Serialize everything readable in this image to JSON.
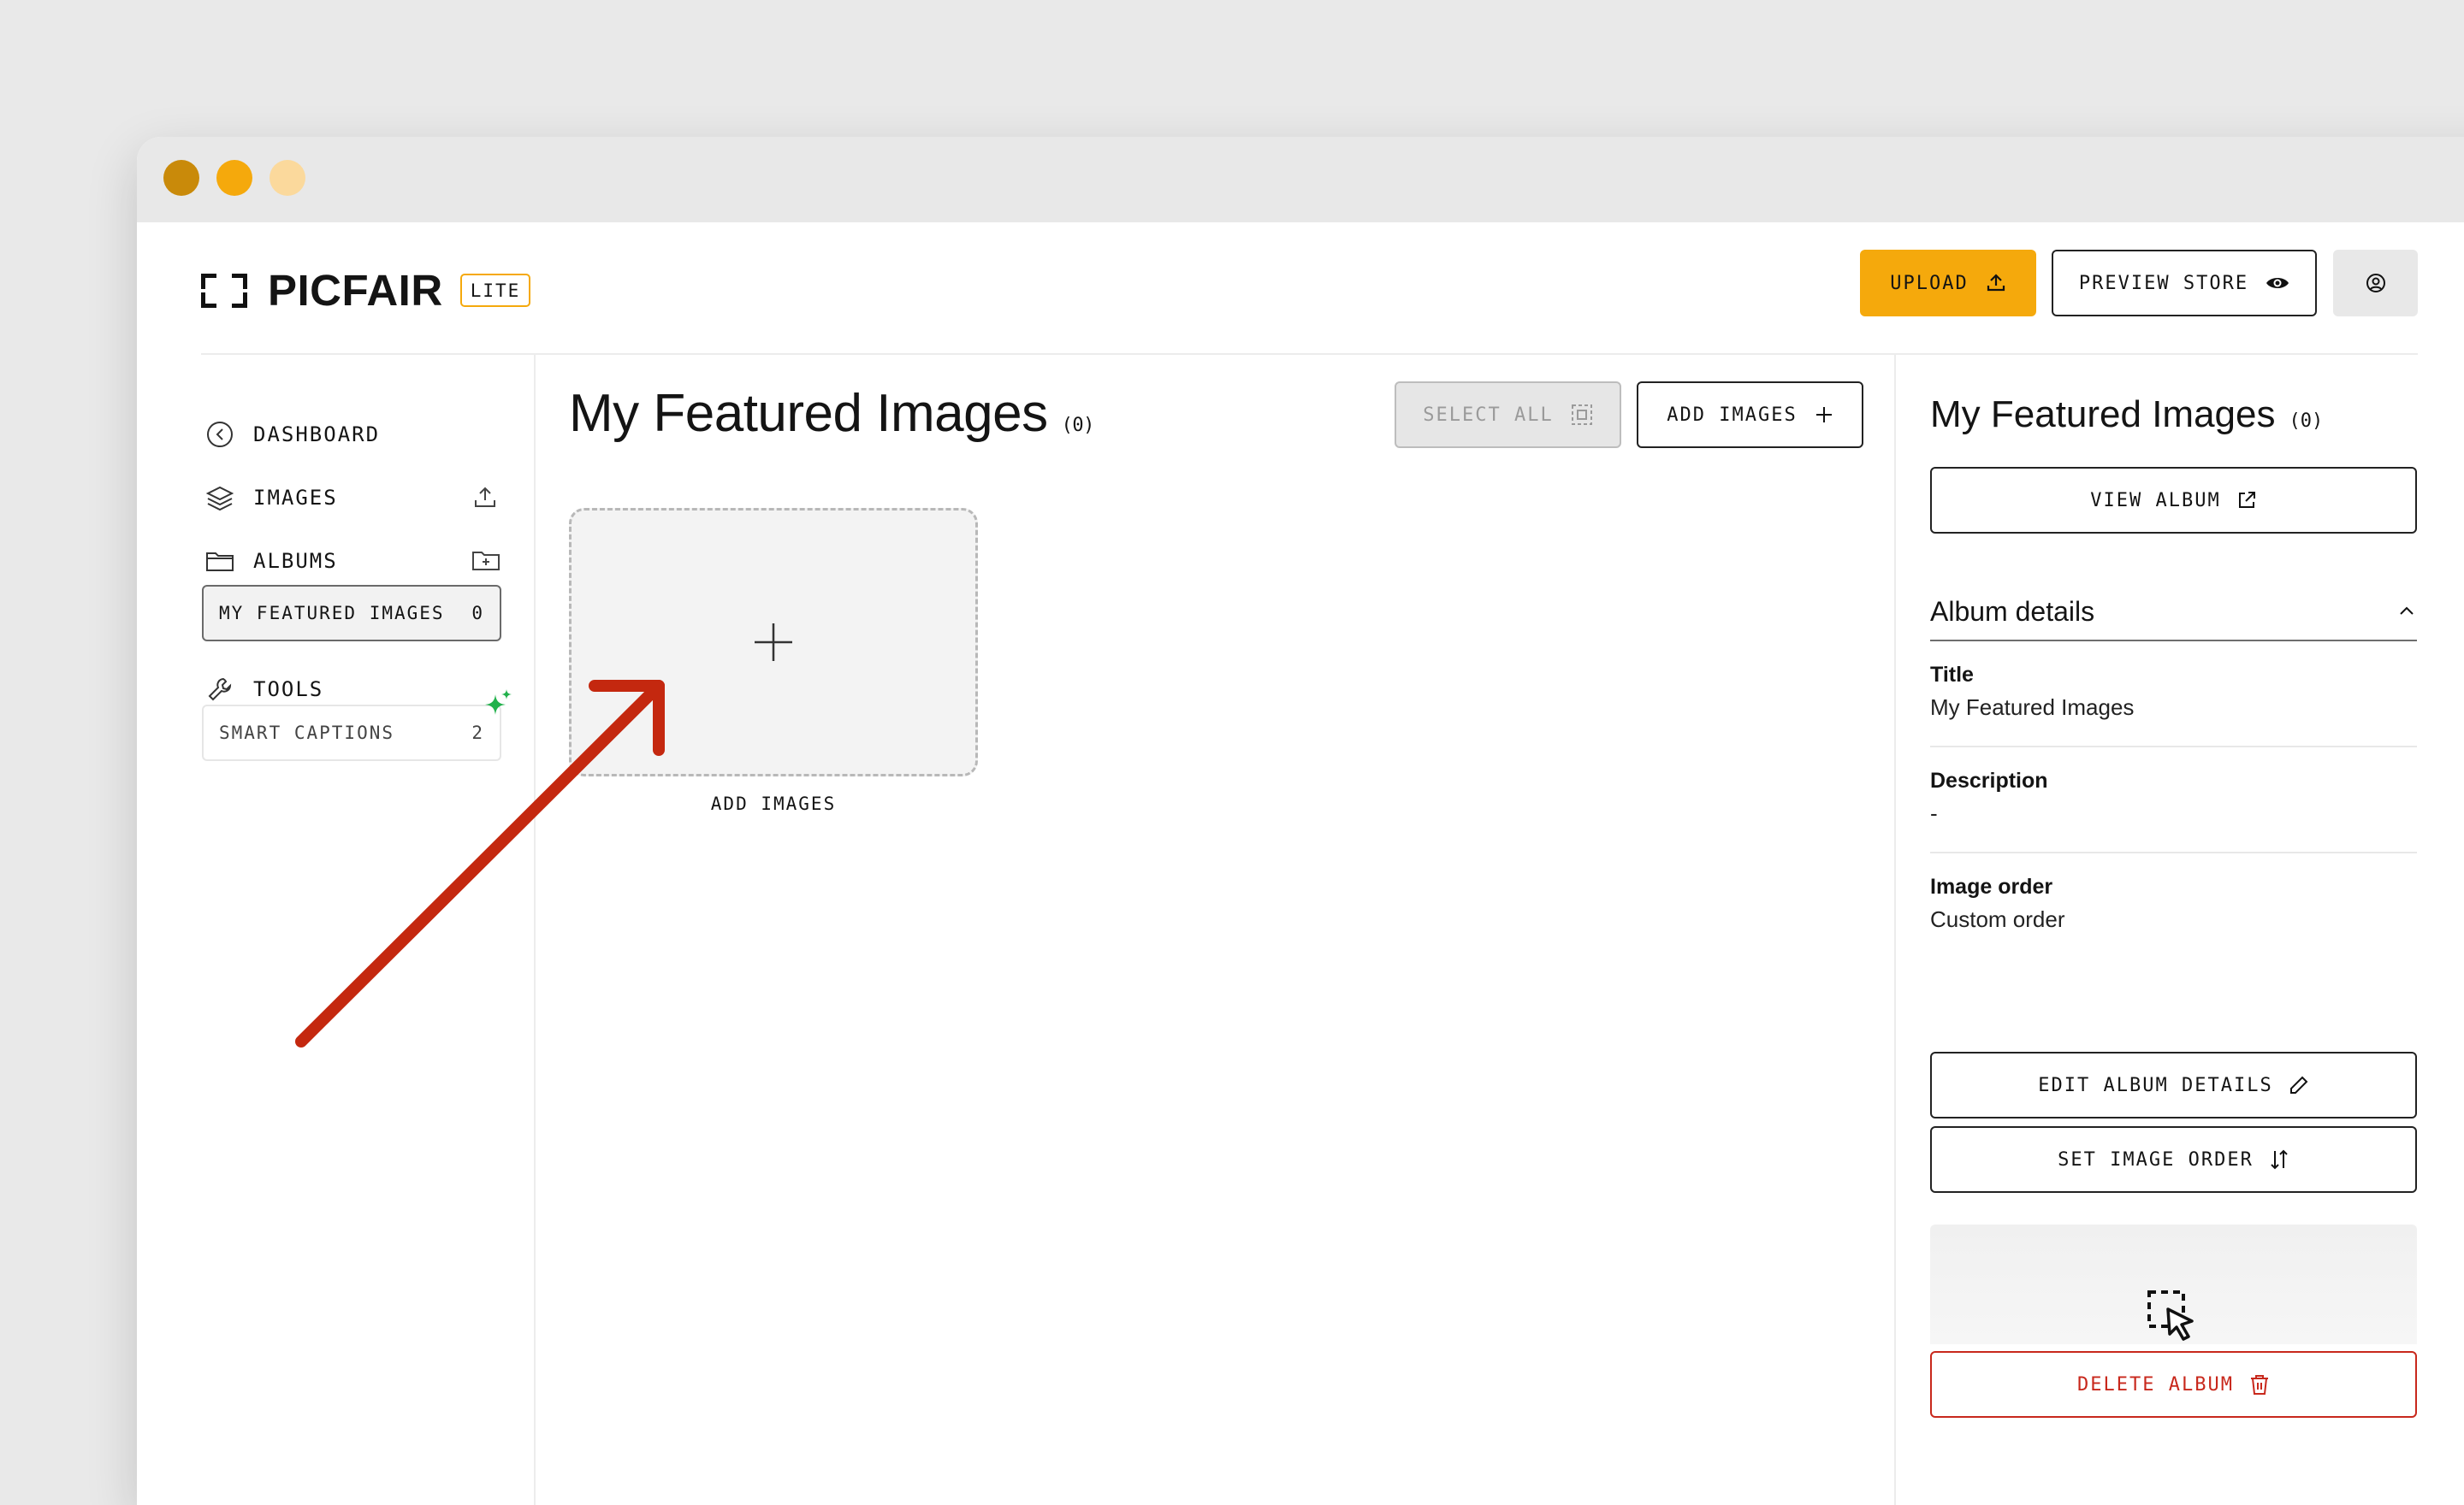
{
  "brand": {
    "name": "PICFAIR",
    "badge": "LITE"
  },
  "header": {
    "upload_label": "UPLOAD",
    "preview_label": "PREVIEW STORE"
  },
  "sidebar": {
    "items": [
      {
        "label": "DASHBOARD",
        "icon": "arrow-left-circle-icon"
      },
      {
        "label": "IMAGES",
        "icon": "layers-icon"
      },
      {
        "label": "ALBUMS",
        "icon": "folder-icon"
      },
      {
        "label": "TOOLS",
        "icon": "wrench-icon"
      }
    ],
    "albums": [
      {
        "label": "MY FEATURED IMAGES",
        "count": "0"
      }
    ],
    "tools": [
      {
        "label": "SMART CAPTIONS",
        "count": "2"
      }
    ]
  },
  "main": {
    "title": "My Featured Images",
    "count": "(0)",
    "select_all_label": "SELECT ALL",
    "add_images_label": "ADD IMAGES",
    "dropzone_label": "ADD IMAGES"
  },
  "panel": {
    "title": "My Featured Images",
    "count": "(0)",
    "view_album_label": "VIEW ALBUM",
    "details_heading": "Album details",
    "fields": [
      {
        "label": "Title",
        "value": "My Featured Images"
      },
      {
        "label": "Description",
        "value": "-"
      },
      {
        "label": "Image order",
        "value": "Custom order"
      }
    ],
    "edit_label": "EDIT ALBUM DETAILS",
    "order_label": "SET IMAGE ORDER",
    "delete_label": "DELETE ALBUM"
  },
  "colors": {
    "accent": "#f5a90c",
    "danger": "#c8281c",
    "annotation_arrow": "#c4280f",
    "sparkle": "#22b14c"
  }
}
